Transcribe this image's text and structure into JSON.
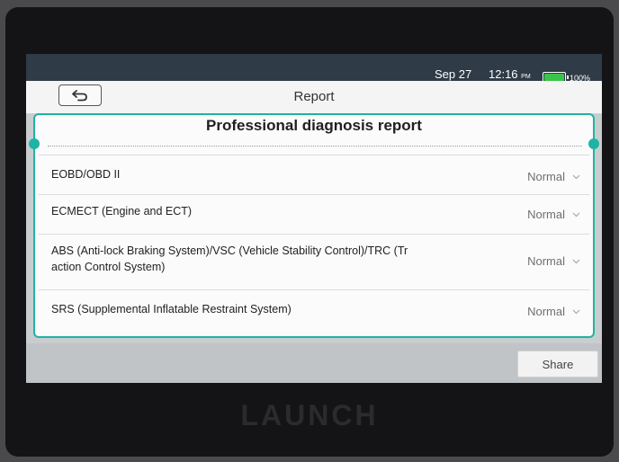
{
  "status_bar": {
    "date": "Sep 27",
    "time": "12:16",
    "ampm": "PM",
    "battery_percent_label": "100%",
    "battery_level": 1.0,
    "battery_color": "#39c54a"
  },
  "header": {
    "title": "Report",
    "back_icon": "back-arrow-icon"
  },
  "report": {
    "title": "Professional diagnosis report",
    "accent_color": "#1fb3a4",
    "items": [
      {
        "name": "EOBD/OBD II",
        "status": "Normal"
      },
      {
        "name": "ECMECT (Engine and ECT)",
        "status": "Normal"
      },
      {
        "name_line1": "ABS (Anti-lock Braking System)/VSC (Vehicle Stability Control)/TRC (Tr",
        "name_line2": "action Control System)",
        "status": "Normal"
      },
      {
        "name": "SRS (Supplemental Inflatable Restraint System)",
        "status": "Normal"
      }
    ]
  },
  "footer": {
    "share_label": "Share"
  },
  "device": {
    "brand": "LAUNCH"
  }
}
